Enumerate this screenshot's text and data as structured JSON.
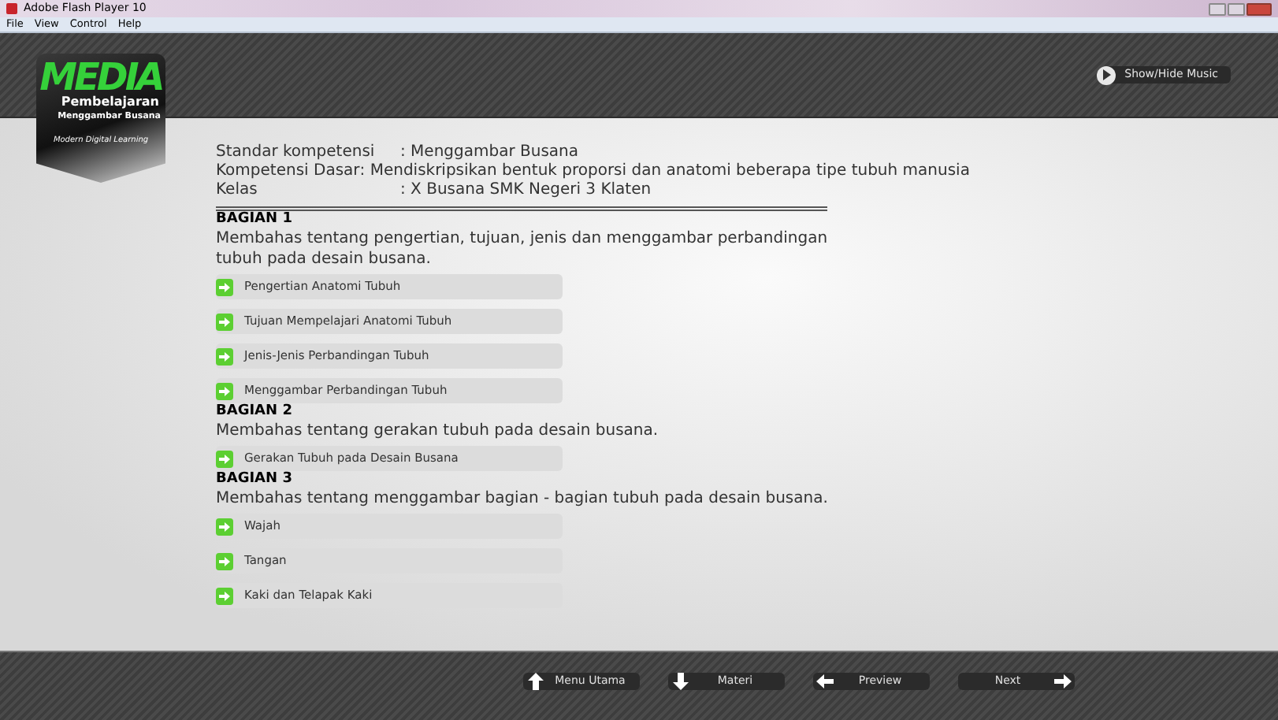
{
  "window": {
    "title": "Adobe Flash Player 10"
  },
  "menu": [
    "File",
    "View",
    "Control",
    "Help"
  ],
  "logo": {
    "title": "MEDIA",
    "subtitle": "Pembelajaran",
    "line": "Menggambar Busana",
    "tagline": "Modern Digital Learning"
  },
  "music_button": {
    "label": "Show/Hide Music"
  },
  "info": [
    {
      "label": "Standar kompetensi",
      "value": ": Menggambar Busana"
    },
    {
      "label": "Kompetensi Dasar",
      "value": ": Mendiskripsikan bentuk proporsi dan  anatomi  beberapa tipe tubuh manusia"
    },
    {
      "label": "Kelas",
      "value": ": X Busana SMK Negeri 3 Klaten"
    }
  ],
  "sections": [
    {
      "title": "BAGIAN 1",
      "description": "Membahas tentang pengertian, tujuan, jenis dan menggambar perbandingan tubuh pada desain busana.",
      "items": [
        "Pengertian Anatomi Tubuh",
        "Tujuan Mempelajari Anatomi Tubuh",
        "Jenis-Jenis Perbandingan Tubuh",
        "Menggambar Perbandingan Tubuh"
      ]
    },
    {
      "title": "BAGIAN 2",
      "description": "Membahas tentang gerakan tubuh pada desain busana.",
      "items": [
        "Gerakan Tubuh pada Desain Busana"
      ]
    },
    {
      "title": "BAGIAN 3",
      "description": "Membahas tentang menggambar bagian - bagian tubuh pada desain busana.",
      "items": [
        "Wajah",
        "Tangan",
        "Kaki dan Telapak Kaki"
      ]
    }
  ],
  "nav": [
    {
      "label": "Menu Utama",
      "kind": "up"
    },
    {
      "label": "Materi",
      "kind": "down"
    },
    {
      "label": "Preview",
      "kind": "left"
    },
    {
      "label": "Next",
      "kind": "right"
    }
  ]
}
